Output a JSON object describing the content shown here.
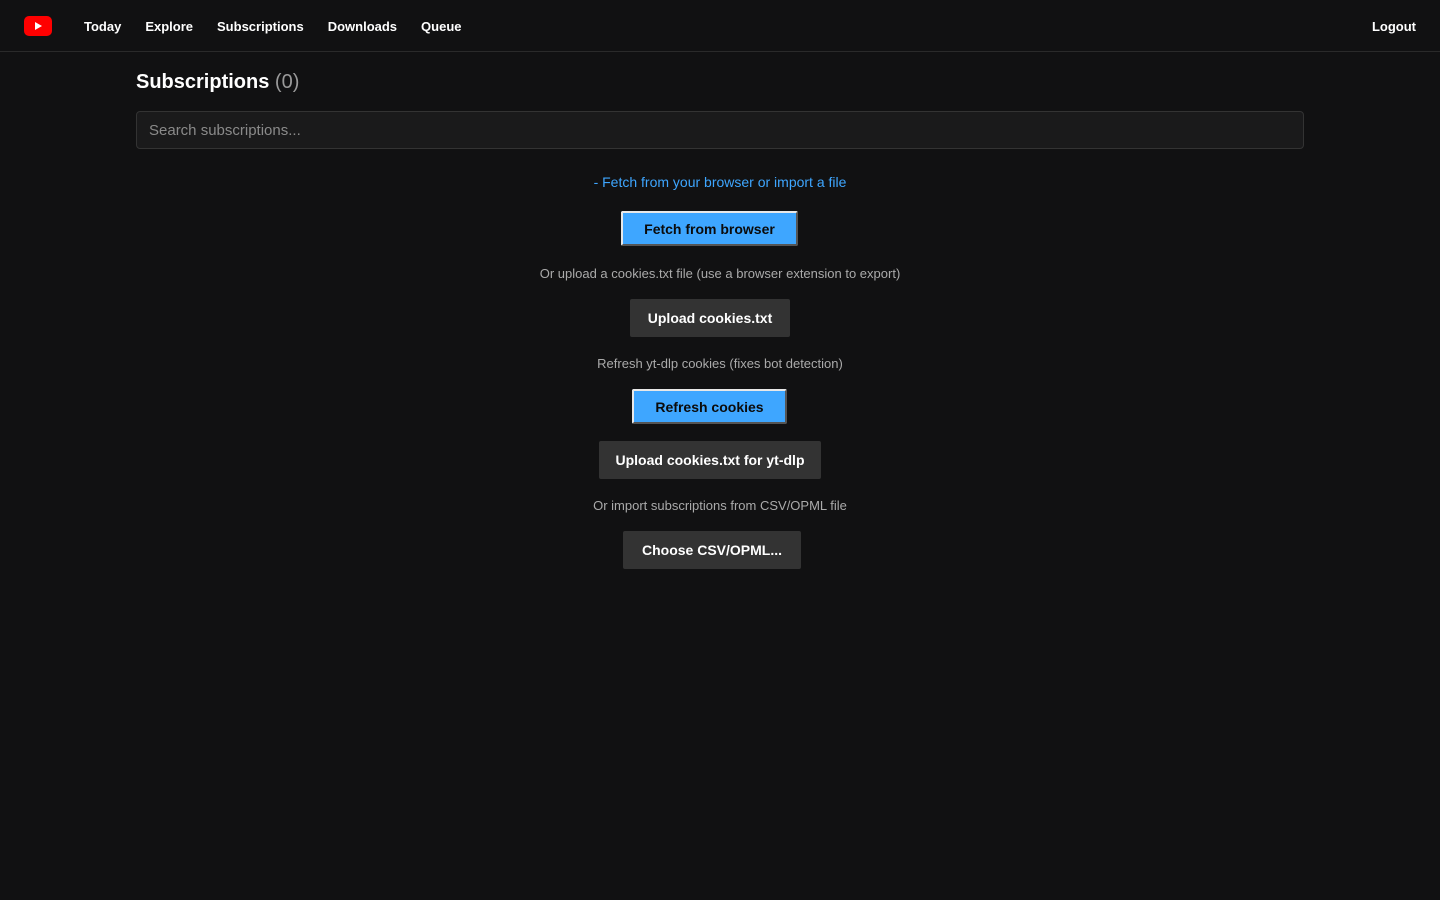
{
  "nav": {
    "items": [
      {
        "label": "Today"
      },
      {
        "label": "Explore"
      },
      {
        "label": "Subscriptions"
      },
      {
        "label": "Downloads"
      },
      {
        "label": "Queue"
      }
    ],
    "logout_label": "Logout",
    "logo_icon": "youtube-play-icon",
    "logo_color": "#ff0000"
  },
  "page": {
    "title": "Subscriptions",
    "count": "(0)"
  },
  "search": {
    "placeholder": "Search subscriptions...",
    "value": ""
  },
  "import": {
    "link_text": "- Fetch from your browser or import a file",
    "fetch_button": "Fetch from browser",
    "upload_hint": "Or upload a cookies.txt file (use a browser extension to export)",
    "upload_button": "Upload cookies.txt",
    "refresh_hint": "Refresh yt-dlp cookies (fixes bot detection)",
    "refresh_button": "Refresh cookies",
    "upload_ytdlp_button": "Upload cookies.txt for yt-dlp",
    "csv_hint": "Or import subscriptions from CSV/OPML file",
    "csv_button": "Choose CSV/OPML..."
  },
  "colors": {
    "background": "#111112",
    "accent": "#3ea6ff",
    "button_dark": "#333333"
  }
}
